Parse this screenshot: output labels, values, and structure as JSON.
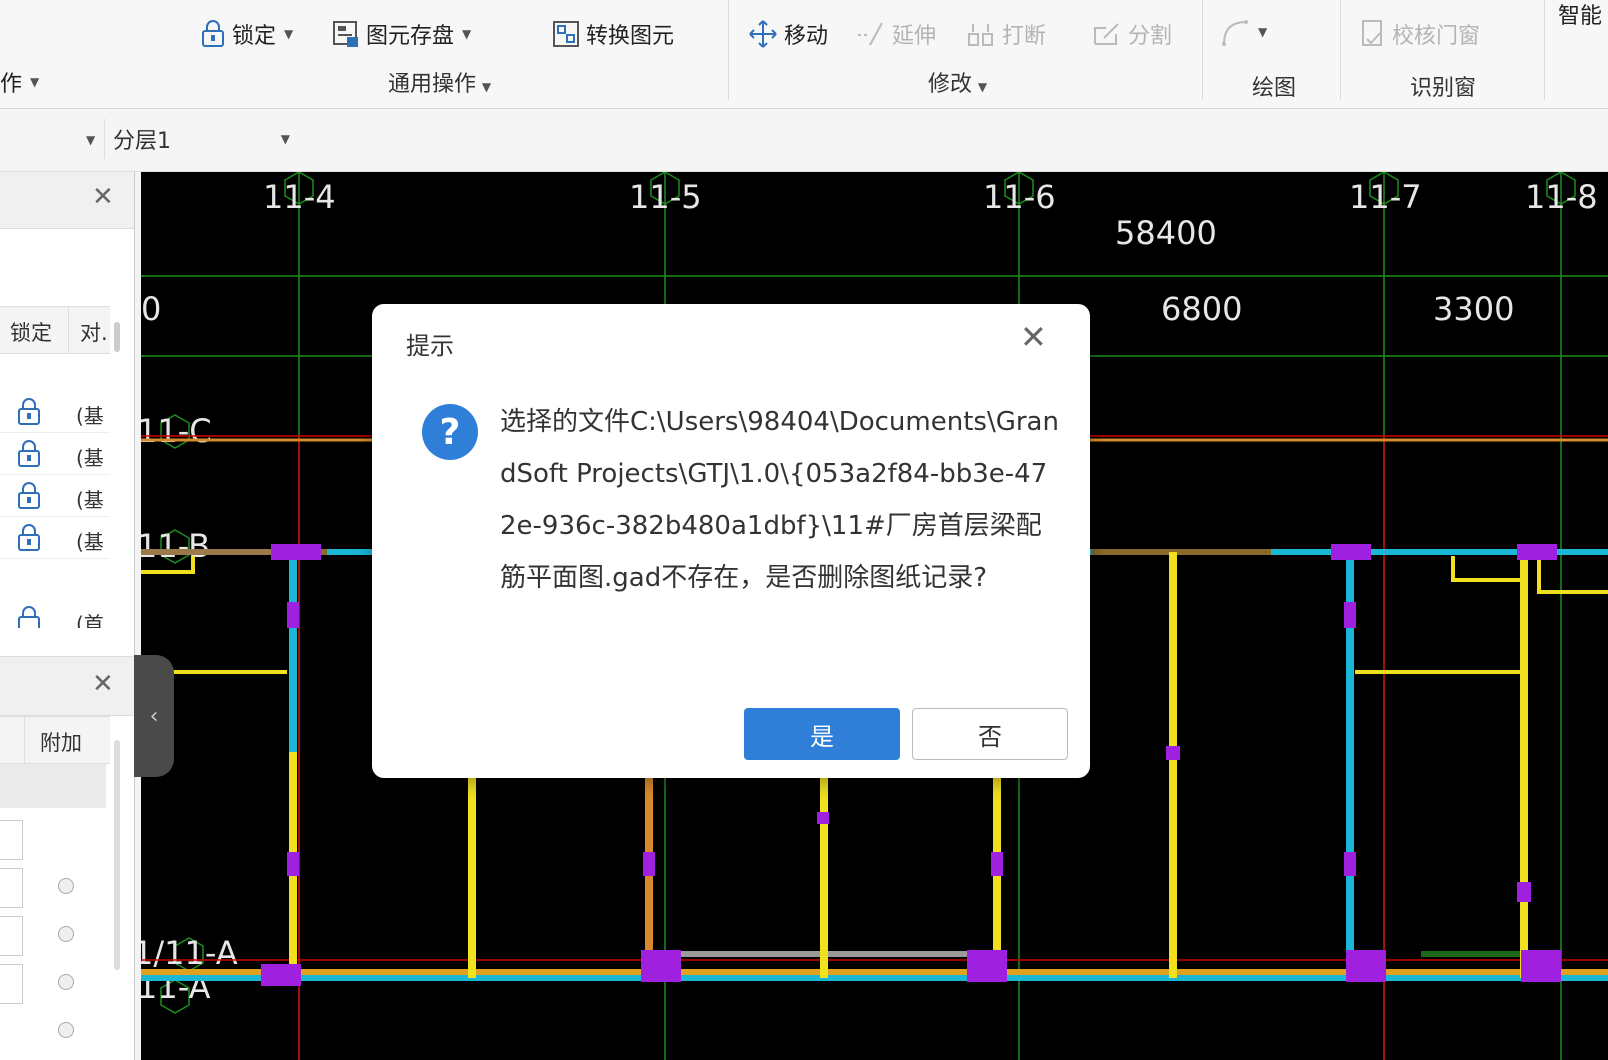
{
  "ribbon": {
    "left_cut_label": "作",
    "lock": "锁定",
    "save_elements": "图元存盘",
    "convert": "转换图元",
    "move": "移动",
    "extend": "延伸",
    "break": "打断",
    "split": "分割",
    "smart_cut": "智能",
    "check_window": "校核门窗",
    "group_general": "通用操作",
    "group_modify": "修改",
    "group_draw": "绘图",
    "group_recognize": "识别窗"
  },
  "toolbar": {
    "layer": "分层1"
  },
  "left_panel": {
    "col_lock": "锁定",
    "col_align": "对.",
    "row_text": "(基",
    "row_text_cut": "(首",
    "col_attach": "附加"
  },
  "drawing": {
    "axes_top": [
      "11-4",
      "11-5",
      "11-6",
      "11-7",
      "11-8"
    ],
    "dim_total": "58400",
    "dim_0": "0",
    "dim_6800": "6800",
    "dim_3300": "3300",
    "axes_left": [
      "11-C",
      "11-B",
      "1/11-A",
      "11-A"
    ]
  },
  "dialog": {
    "title": "提示",
    "message": "选择的文件C:\\Users\\98404\\Documents\\GrandSoft Projects\\GTJ\\1.0\\{053a2f84-bb3e-472e-936c-382b480a1dbf}\\11#厂房首层梁配筋平面图.gad不存在，是否删除图纸记录?",
    "yes": "是",
    "no": "否"
  },
  "colors": {
    "accent": "#2f7ed8",
    "canvas": "#000000"
  }
}
